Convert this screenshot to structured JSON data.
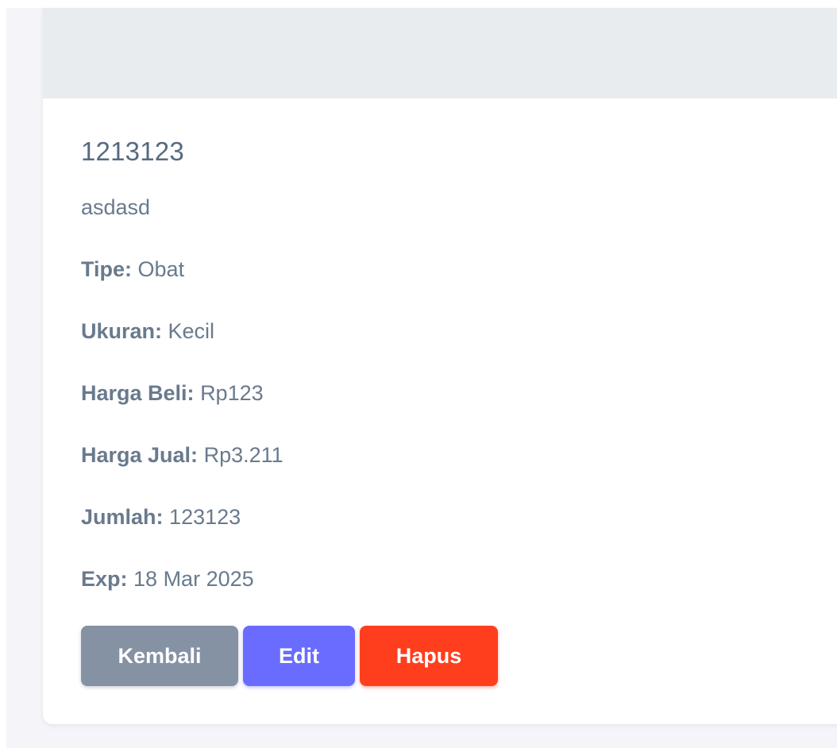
{
  "item": {
    "title": "1213123",
    "description": "asdasd",
    "fields": [
      {
        "label": "Tipe:",
        "value": "Obat"
      },
      {
        "label": "Ukuran:",
        "value": "Kecil"
      },
      {
        "label": "Harga Beli:",
        "value": "Rp123"
      },
      {
        "label": "Harga Jual:",
        "value": "Rp3.211"
      },
      {
        "label": "Jumlah:",
        "value": "123123"
      },
      {
        "label": "Exp:",
        "value": "18 Mar 2025"
      }
    ]
  },
  "actions": {
    "back_label": "Kembali",
    "edit_label": "Edit",
    "delete_label": "Hapus"
  },
  "colors": {
    "back": "#8592a3",
    "edit": "#696cff",
    "delete": "#ff3e1d",
    "header": "#e8ecef"
  }
}
